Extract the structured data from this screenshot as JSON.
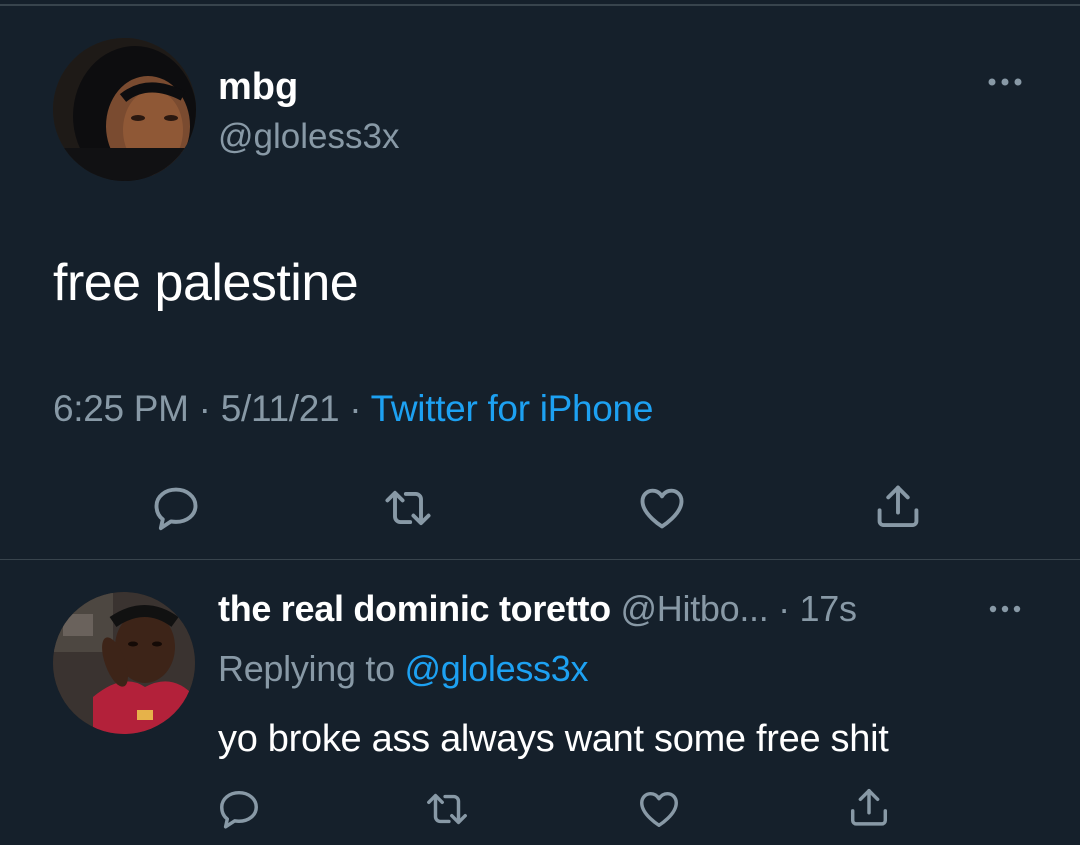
{
  "main_tweet": {
    "display_name": "mbg",
    "handle": "@gloless3x",
    "text": "free palestine",
    "time": "6:25 PM",
    "date": "5/11/21",
    "source": "Twitter for iPhone",
    "separator": " · "
  },
  "reply": {
    "display_name": "the real dominic toretto",
    "handle": "@Hitbo...",
    "time_sep": " · ",
    "time": "17s",
    "replying_prefix": "Replying to ",
    "replying_to": "@gloless3x",
    "text": "yo broke ass always want some free shit"
  },
  "icons": {
    "reply": "reply-icon",
    "retweet": "retweet-icon",
    "like": "heart-icon",
    "share": "share-icon",
    "more": "more-icon"
  },
  "colors": {
    "background": "#15202b",
    "secondary_text": "#8899a6",
    "link": "#1da1f2",
    "divider": "#38444d"
  }
}
